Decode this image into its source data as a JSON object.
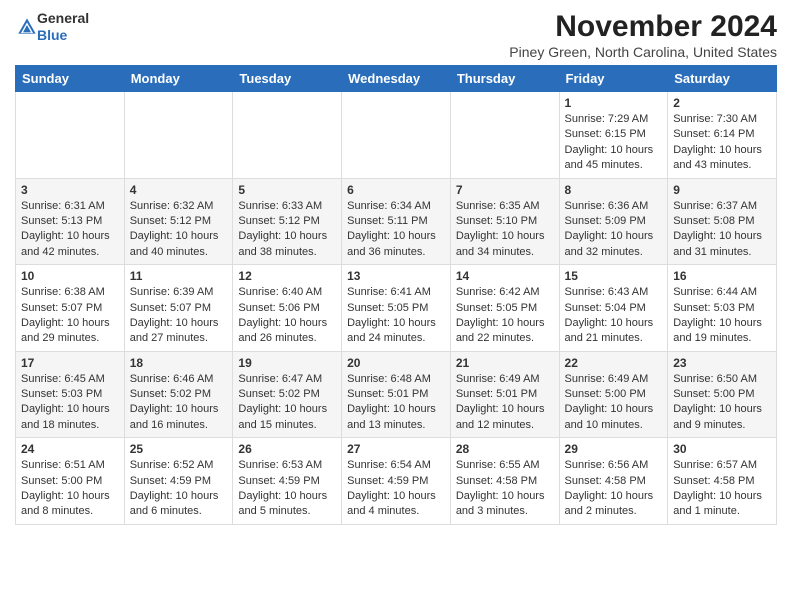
{
  "header": {
    "logo_general": "General",
    "logo_blue": "Blue",
    "month_title": "November 2024",
    "location": "Piney Green, North Carolina, United States"
  },
  "weekdays": [
    "Sunday",
    "Monday",
    "Tuesday",
    "Wednesday",
    "Thursday",
    "Friday",
    "Saturday"
  ],
  "weeks": [
    [
      {
        "day": "",
        "info": ""
      },
      {
        "day": "",
        "info": ""
      },
      {
        "day": "",
        "info": ""
      },
      {
        "day": "",
        "info": ""
      },
      {
        "day": "",
        "info": ""
      },
      {
        "day": "1",
        "info": "Sunrise: 7:29 AM\nSunset: 6:15 PM\nDaylight: 10 hours and 45 minutes."
      },
      {
        "day": "2",
        "info": "Sunrise: 7:30 AM\nSunset: 6:14 PM\nDaylight: 10 hours and 43 minutes."
      }
    ],
    [
      {
        "day": "3",
        "info": "Sunrise: 6:31 AM\nSunset: 5:13 PM\nDaylight: 10 hours and 42 minutes."
      },
      {
        "day": "4",
        "info": "Sunrise: 6:32 AM\nSunset: 5:12 PM\nDaylight: 10 hours and 40 minutes."
      },
      {
        "day": "5",
        "info": "Sunrise: 6:33 AM\nSunset: 5:12 PM\nDaylight: 10 hours and 38 minutes."
      },
      {
        "day": "6",
        "info": "Sunrise: 6:34 AM\nSunset: 5:11 PM\nDaylight: 10 hours and 36 minutes."
      },
      {
        "day": "7",
        "info": "Sunrise: 6:35 AM\nSunset: 5:10 PM\nDaylight: 10 hours and 34 minutes."
      },
      {
        "day": "8",
        "info": "Sunrise: 6:36 AM\nSunset: 5:09 PM\nDaylight: 10 hours and 32 minutes."
      },
      {
        "day": "9",
        "info": "Sunrise: 6:37 AM\nSunset: 5:08 PM\nDaylight: 10 hours and 31 minutes."
      }
    ],
    [
      {
        "day": "10",
        "info": "Sunrise: 6:38 AM\nSunset: 5:07 PM\nDaylight: 10 hours and 29 minutes."
      },
      {
        "day": "11",
        "info": "Sunrise: 6:39 AM\nSunset: 5:07 PM\nDaylight: 10 hours and 27 minutes."
      },
      {
        "day": "12",
        "info": "Sunrise: 6:40 AM\nSunset: 5:06 PM\nDaylight: 10 hours and 26 minutes."
      },
      {
        "day": "13",
        "info": "Sunrise: 6:41 AM\nSunset: 5:05 PM\nDaylight: 10 hours and 24 minutes."
      },
      {
        "day": "14",
        "info": "Sunrise: 6:42 AM\nSunset: 5:05 PM\nDaylight: 10 hours and 22 minutes."
      },
      {
        "day": "15",
        "info": "Sunrise: 6:43 AM\nSunset: 5:04 PM\nDaylight: 10 hours and 21 minutes."
      },
      {
        "day": "16",
        "info": "Sunrise: 6:44 AM\nSunset: 5:03 PM\nDaylight: 10 hours and 19 minutes."
      }
    ],
    [
      {
        "day": "17",
        "info": "Sunrise: 6:45 AM\nSunset: 5:03 PM\nDaylight: 10 hours and 18 minutes."
      },
      {
        "day": "18",
        "info": "Sunrise: 6:46 AM\nSunset: 5:02 PM\nDaylight: 10 hours and 16 minutes."
      },
      {
        "day": "19",
        "info": "Sunrise: 6:47 AM\nSunset: 5:02 PM\nDaylight: 10 hours and 15 minutes."
      },
      {
        "day": "20",
        "info": "Sunrise: 6:48 AM\nSunset: 5:01 PM\nDaylight: 10 hours and 13 minutes."
      },
      {
        "day": "21",
        "info": "Sunrise: 6:49 AM\nSunset: 5:01 PM\nDaylight: 10 hours and 12 minutes."
      },
      {
        "day": "22",
        "info": "Sunrise: 6:49 AM\nSunset: 5:00 PM\nDaylight: 10 hours and 10 minutes."
      },
      {
        "day": "23",
        "info": "Sunrise: 6:50 AM\nSunset: 5:00 PM\nDaylight: 10 hours and 9 minutes."
      }
    ],
    [
      {
        "day": "24",
        "info": "Sunrise: 6:51 AM\nSunset: 5:00 PM\nDaylight: 10 hours and 8 minutes."
      },
      {
        "day": "25",
        "info": "Sunrise: 6:52 AM\nSunset: 4:59 PM\nDaylight: 10 hours and 6 minutes."
      },
      {
        "day": "26",
        "info": "Sunrise: 6:53 AM\nSunset: 4:59 PM\nDaylight: 10 hours and 5 minutes."
      },
      {
        "day": "27",
        "info": "Sunrise: 6:54 AM\nSunset: 4:59 PM\nDaylight: 10 hours and 4 minutes."
      },
      {
        "day": "28",
        "info": "Sunrise: 6:55 AM\nSunset: 4:58 PM\nDaylight: 10 hours and 3 minutes."
      },
      {
        "day": "29",
        "info": "Sunrise: 6:56 AM\nSunset: 4:58 PM\nDaylight: 10 hours and 2 minutes."
      },
      {
        "day": "30",
        "info": "Sunrise: 6:57 AM\nSunset: 4:58 PM\nDaylight: 10 hours and 1 minute."
      }
    ]
  ]
}
